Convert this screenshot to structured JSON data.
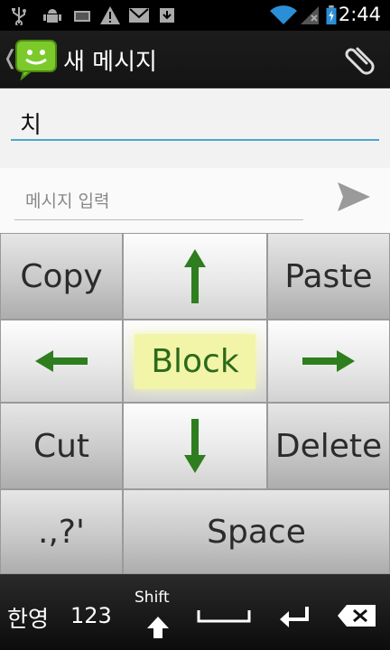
{
  "status_bar": {
    "time": "2:44",
    "icons": [
      "usb-icon",
      "android-debug-icon",
      "device-icon",
      "warning-icon",
      "gmail-icon",
      "download-icon",
      "wifi-icon",
      "no-signal-icon",
      "battery-charging-icon"
    ]
  },
  "action_bar": {
    "title": "새 메시지",
    "icons": [
      "back-chevron-icon",
      "messaging-app-icon",
      "attach-icon"
    ]
  },
  "compose": {
    "to_value": "치",
    "message_placeholder": "메시지 입력"
  },
  "keyboard": {
    "keys": {
      "copy": "Copy",
      "paste": "Paste",
      "block": "Block",
      "cut": "Cut",
      "delete": "Delete",
      "punct": ".,?'",
      "space": "Space"
    },
    "arrow_color": "#2e7d1e"
  },
  "bottom_bar": {
    "lang": "한영",
    "numbers": "123",
    "shift": "Shift",
    "icons": [
      "shift-arrow-icon",
      "space-bar-icon",
      "enter-icon",
      "backspace-icon"
    ]
  }
}
